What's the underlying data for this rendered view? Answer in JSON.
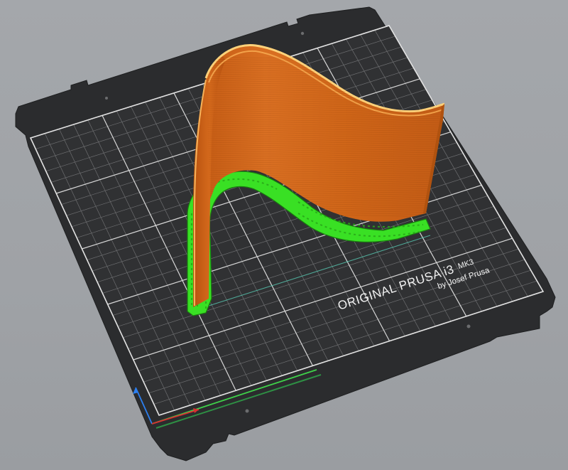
{
  "viewport": {
    "name": "3D view"
  },
  "bed": {
    "brand_line": "ORIGINAL PRUSA i3",
    "model_suffix": "MK3",
    "byline": "by Josef Prusa",
    "colors": {
      "plate": "#2b2c2e",
      "grid_minor": "#6d6e70",
      "grid_major": "#d7d7d7",
      "background": "#a0a3a7"
    }
  },
  "object": {
    "name": "wave-shaped vertical wall",
    "colors": {
      "print": "#d0671c",
      "print_highlight": "#ffd27a",
      "brim": "#39e024",
      "brim_dark": "#1a7d10"
    }
  },
  "axes": {
    "x_color": "#d93030",
    "y_color": "#3fd24a",
    "z_color": "#2c7ff0"
  }
}
